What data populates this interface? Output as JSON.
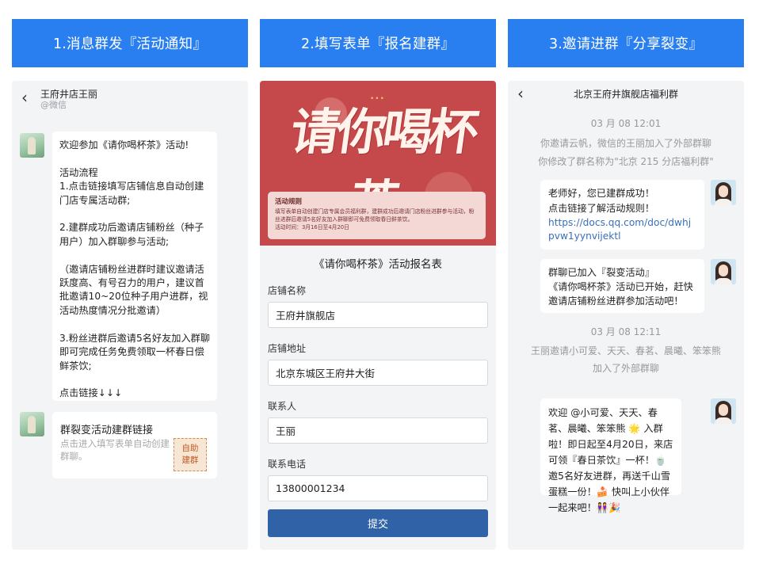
{
  "columns": [
    {
      "header": "1.消息群发『活动通知』"
    },
    {
      "header": "2.填写表单『报名建群』"
    },
    {
      "header": "3.邀请进群『分享裂变』"
    }
  ],
  "panel1": {
    "back_icon": "‹",
    "contact_name": "王府井店王丽",
    "contact_sub": "@微信",
    "message1": "欢迎参加《请你喝杯茶》活动!\n\n活动流程\n1.点击链接填写店铺信息自动创建门店专属活动群;\n\n2.建群成功后邀请店铺粉丝（种子用户）加入群聊参与活动;\n\n（邀请店铺粉丝进群时建议邀请活跃度高、有号召力的用户，建议首批邀请10~20位种子用户进群，视活动热度情况分批邀请）\n\n3.粉丝进群后邀请5名好友加入群聊即可完成任务免费领取一杯春日偿鲜茶饮;\n\n点击链接↓↓↓",
    "card": {
      "title": "群裂变活动建群链接",
      "desc": "点击进入填写表单自动创建群聊。",
      "stamp_line1": "自助",
      "stamp_line2": "建群"
    }
  },
  "panel2": {
    "poster_dots": "•••",
    "poster_title": "请你喝杯茶",
    "rules_title": "活动规则",
    "rules_body": "填写表单自动创建门店专属会员福利群，建群成功后邀请门店粉丝进群参与活动，粉丝进群后邀请5名好友加入群聊即可免费领取春日鲜茶饮。\n活动时间：3月16日至4月20日",
    "form_title": "《请你喝杯茶》活动报名表",
    "fields": [
      {
        "label": "店铺名称",
        "value": "王府井旗舰店"
      },
      {
        "label": "店铺地址",
        "value": "北京东城区王府井大街"
      },
      {
        "label": "联系人",
        "value": "王丽"
      },
      {
        "label": "联系电话",
        "value": "13800001234"
      }
    ],
    "submit_label": "提交"
  },
  "panel3": {
    "back_icon": "‹",
    "group_title": "北京王府井旗舰店福利群",
    "time1": "03 月 08 12:01",
    "sys1": "你邀请云帆，微信的王丽加入了外部群聊",
    "sys2": "你修改了群名称为\"北京 215 分店福利群\"",
    "msg1_text": "老师好，您已建群成功！\n点击链接了解活动规则！",
    "msg1_link": "https://docs.qq.com/doc/dwhjpvw1yynvijektl",
    "msg2": "群聊已加入『裂变活动』\n《请你喝杯茶》活动已开始，赶快邀请店铺粉丝进群参加活动吧！",
    "time2": "03 月 08 12:11",
    "sys3_line1": "王丽邀请小可爱、天天、春茗、晨曦、笨笨熊",
    "sys3_line2": "加入了外部群聊",
    "msg3": "欢迎 @小可爱、天天、春茗、晨曦、笨笨熊 🌟 入群啦！即日起至4月20日，来店可领『春日茶饮』一杯！🍵 邀5名好友进群，再送千山雪蛋糕一份！🍰 快叫上小伙伴一起来吧！👭🎉"
  }
}
